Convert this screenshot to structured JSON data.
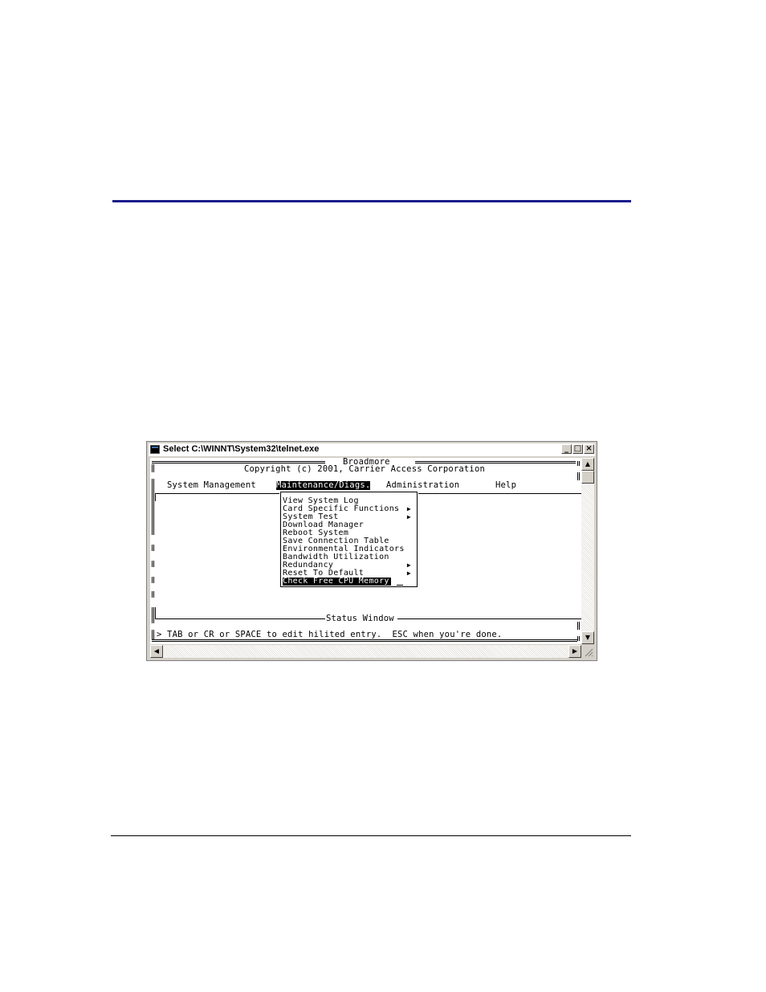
{
  "window": {
    "title": "Select C:\\WINNT\\System32\\telnet.exe",
    "controls": {
      "minimize": "_",
      "maximize": "□",
      "close": "×"
    }
  },
  "console": {
    "banner_title": "Broadmore",
    "copyright": "Copyright (c) 2001, Carrier Access Corporation",
    "menubar": [
      {
        "label": "System Management",
        "selected": false
      },
      {
        "label": "Maintenance/Diags.",
        "selected": true
      },
      {
        "label": "Administration",
        "selected": false
      },
      {
        "label": "Help",
        "selected": false
      }
    ],
    "dropdown": [
      {
        "label": "View System Log",
        "submenu": false,
        "selected": false
      },
      {
        "label": "Card Specific Functions",
        "submenu": true,
        "selected": false
      },
      {
        "label": "System Test",
        "submenu": true,
        "selected": false
      },
      {
        "label": "Download Manager",
        "submenu": false,
        "selected": false
      },
      {
        "label": "Reboot System",
        "submenu": false,
        "selected": false
      },
      {
        "label": "Save Connection Table",
        "submenu": false,
        "selected": false
      },
      {
        "label": "Environmental Indicators",
        "submenu": false,
        "selected": false
      },
      {
        "label": "Bandwidth Utilization",
        "submenu": false,
        "selected": false
      },
      {
        "label": "Redundancy",
        "submenu": true,
        "selected": false
      },
      {
        "label": "Reset To Default",
        "submenu": true,
        "selected": false
      },
      {
        "label": "Check Free CPU Memory",
        "submenu": false,
        "selected": true
      }
    ],
    "submenu_arrow": "▶",
    "status_window_title": "Status Window",
    "status_message": "> TAB or CR or SPACE to edit hilited entry.  ESC when you're done."
  },
  "scrollbar": {
    "up": "▲",
    "down": "▼",
    "left": "◀",
    "right": "▶"
  },
  "colors": {
    "rule_top": "#1c1c8c",
    "window_chrome": "#d4d0c8",
    "highlight_bg": "#000000",
    "highlight_fg": "#ffffff"
  }
}
